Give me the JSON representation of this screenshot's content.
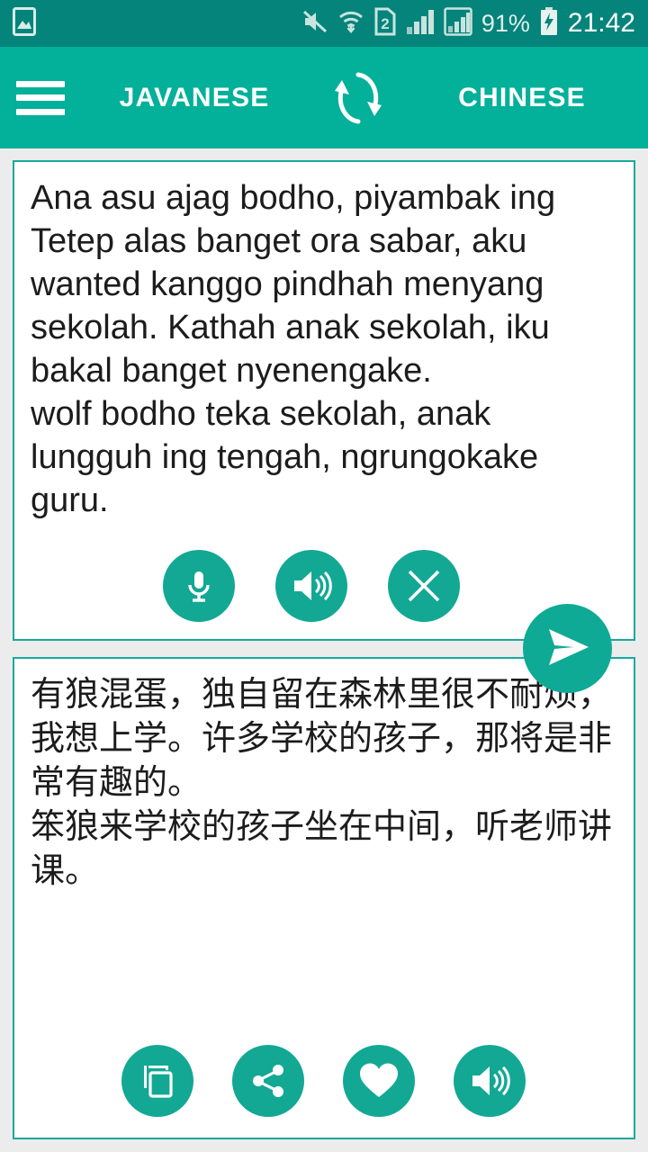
{
  "status_bar": {
    "left_icons": [
      "image-icon"
    ],
    "right_icons": [
      "mute-icon",
      "wifi-icon",
      "sim-2-icon",
      "signal-1-icon",
      "signal-2-icon"
    ],
    "battery_percent": "91%",
    "battery_icon": "battery-charging-icon",
    "clock": "21:42",
    "background_color": "#04847a"
  },
  "toolbar": {
    "menu_icon": "hamburger-menu-icon",
    "source_language": "JAVANESE",
    "swap_icon": "swap-languages-icon",
    "target_language": "CHINESE",
    "background_color": "#03b09a"
  },
  "source_card": {
    "text": "Ana asu ajag bodho, piyambak ing Tetep alas banget ora sabar, aku wanted kanggo pindhah menyang sekolah. Kathah anak sekolah, iku bakal banget nyenengake.\nwolf bodho teka sekolah, anak lungguh ing tengah, ngrungokake guru.",
    "actions": [
      {
        "name": "mic-button",
        "icon": "microphone-icon"
      },
      {
        "name": "speak-button",
        "icon": "speaker-icon"
      },
      {
        "name": "clear-button",
        "icon": "close-icon"
      }
    ]
  },
  "translate_button": {
    "icon": "send-icon",
    "color": "#0faa95"
  },
  "target_card": {
    "text": "有狼混蛋，独自留在森林里很不耐烦，我想上学。许多学校的孩子，那将是非常有趣的。\n笨狼来学校的孩子坐在中间，听老师讲课。",
    "actions": [
      {
        "name": "copy-button",
        "icon": "copy-icon"
      },
      {
        "name": "share-button",
        "icon": "share-icon"
      },
      {
        "name": "favorite-button",
        "icon": "heart-icon"
      },
      {
        "name": "speak-button",
        "icon": "speaker-icon"
      }
    ]
  },
  "theme": {
    "accent": "#03b09a",
    "button": "#12a894",
    "card_border": "#19a99b",
    "page_background": "#ececec"
  }
}
